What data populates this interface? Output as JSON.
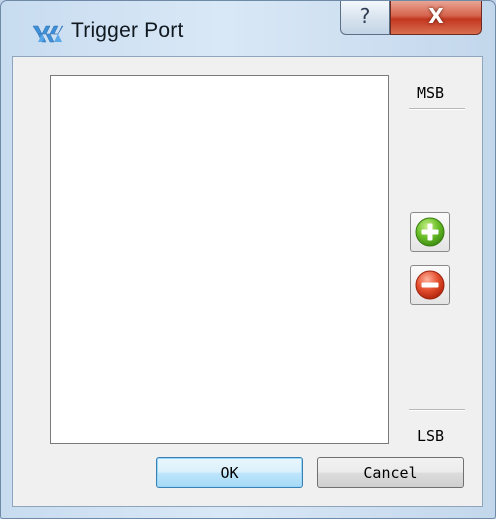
{
  "window": {
    "title": "Trigger Port",
    "help_glyph": "?",
    "close_glyph": "X",
    "icon": "trigger-logo-icon"
  },
  "bit_order": {
    "top_label": "MSB",
    "bottom_label": "LSB"
  },
  "actions": {
    "add_icon": "plus-circle-icon",
    "remove_icon": "minus-circle-icon",
    "ok_label": "OK",
    "cancel_label": "Cancel"
  },
  "colors": {
    "add": "#5fb61e",
    "remove": "#e0452c",
    "ok_border": "#3c7fb1"
  },
  "port_list": []
}
